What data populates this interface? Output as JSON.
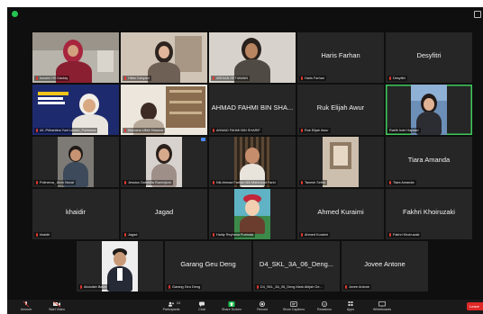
{
  "window": {
    "security_indicator": "green-shield-icon"
  },
  "tiles": [
    {
      "type": "video",
      "label": "Ismaini HS Daulay",
      "muted": true
    },
    {
      "type": "video",
      "label": "Hilda Cahyani",
      "muted": true
    },
    {
      "type": "video",
      "label": "ARDIAN SETIAWAN",
      "muted": true
    },
    {
      "type": "name",
      "name": "Haris Farhan",
      "label": "Haris Farhan",
      "muted": true
    },
    {
      "type": "name",
      "name": "Desyfitri",
      "label": "Desyfitri",
      "muted": true
    },
    {
      "type": "video",
      "label": "44 -Prihantina Yuni Lestari_Polinema",
      "muted": true
    },
    {
      "type": "video",
      "label": "Mumana Ulfah Hasana",
      "muted": true
    },
    {
      "type": "name",
      "name": "AHMAD FAHMI BIN SHA...",
      "label": "AHMAD FAHMI BIN SHARIF",
      "muted": true
    },
    {
      "type": "name",
      "name": "Ruk Elijah Awur",
      "label": "Ruk Elijah Awur",
      "muted": true
    },
    {
      "type": "video",
      "label": "Rakfh Indri Hapsari",
      "muted": false,
      "active": true
    },
    {
      "type": "video",
      "label": "Polinema_ Alvin Noval",
      "muted": true
    },
    {
      "type": "video",
      "label": "Jessica Gabriella Ravenjiom",
      "muted": true,
      "sharing": true
    },
    {
      "type": "video",
      "label": "Nik Ahmad Farhan Nik Mahmood Farid",
      "muted": true
    },
    {
      "type": "video",
      "label": "Tanesh Sethu",
      "muted": true
    },
    {
      "type": "name",
      "name": "Tiara Amanda",
      "label": "Tiara Amanda",
      "muted": true
    },
    {
      "type": "name",
      "name": "khaidir",
      "label": "khaidir",
      "muted": true
    },
    {
      "type": "name",
      "name": "Jagad",
      "label": "Jagad",
      "muted": true
    },
    {
      "type": "video",
      "label": "Haldy Reyhana Putrinda",
      "muted": true
    },
    {
      "type": "name",
      "name": "Ahmed Kuraimi",
      "label": "Ahmed Kuraimi",
      "muted": true
    },
    {
      "type": "name",
      "name": "Fakhri Khoiruzaki",
      "label": "Fakhri Khoiruzaki",
      "muted": true
    },
    {
      "type": "video",
      "label": "Abdullah Baker",
      "muted": true
    },
    {
      "type": "name",
      "name": "Garang Geu Deng",
      "label": "Garang Geu Deng",
      "muted": true
    },
    {
      "type": "name",
      "name": "D4_SKL_3A_06_Deng...",
      "label": "D4_SKL_3A_06_Deng Mark Abijah Ge...",
      "muted": true
    },
    {
      "type": "name",
      "name": "Jovee Antone",
      "label": "Jovee Antone",
      "muted": true
    }
  ],
  "toolbar": {
    "unmute": "Unmute",
    "start_video": "Start Video",
    "participants": "Participants",
    "participants_count": "24",
    "chat": "Chat",
    "share_screen": "Share Screen",
    "record": "Record",
    "show_captions": "Show Captions",
    "reactions": "Reactions",
    "apps": "Apps",
    "whiteboards": "Whiteboards",
    "leave": "Leave"
  },
  "colors": {
    "active_speaker": "#3ec95b",
    "leave": "#e02828",
    "share": "#23c552",
    "muted_mic": "#e2372f"
  }
}
